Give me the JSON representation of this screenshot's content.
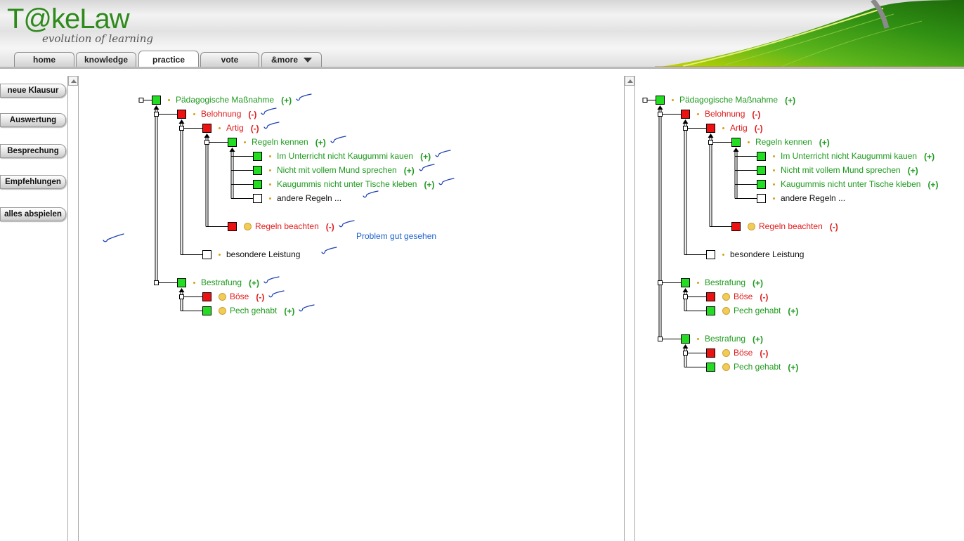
{
  "app": {
    "logo": "T@keLaw",
    "tagline": "evolution of learning"
  },
  "tabs": [
    {
      "label": "home",
      "active": false
    },
    {
      "label": "knowledge",
      "active": false
    },
    {
      "label": "practice",
      "active": true
    },
    {
      "label": "vote",
      "active": false
    },
    {
      "label": "&more",
      "active": false,
      "has_dropdown": true
    }
  ],
  "sidebar": {
    "buttons": [
      {
        "label": "neue Klausur"
      },
      {
        "label": "Auswertung"
      },
      {
        "label": "Besprechung"
      },
      {
        "label": "Empfehlungen"
      },
      {
        "label": "alles abspielen"
      }
    ]
  },
  "colors": {
    "green": "#1f9a1f",
    "box_green": "#22dd22",
    "red": "#e01b1b",
    "box_red": "#ee1111",
    "comment": "#1f62d1",
    "annotation_ink": "#1b3fb5",
    "bullet": "#d4a017",
    "circle": "#f2cc55"
  },
  "left_panel": {
    "nodes": [
      {
        "id": "L1",
        "label": "Pädagogische Maßnahme",
        "sign": "(+)",
        "box": "green",
        "color": "green",
        "level": 0,
        "row": 0,
        "circle": false
      },
      {
        "id": "L2",
        "label": "Belohnung",
        "sign": "(-)",
        "box": "red",
        "color": "red",
        "level": 1,
        "row": 1,
        "circle": false
      },
      {
        "id": "L3",
        "label": "Artig",
        "sign": "(-)",
        "box": "red",
        "color": "red",
        "level": 2,
        "row": 2,
        "circle": false
      },
      {
        "id": "L4",
        "label": "Regeln kennen",
        "sign": "(+)",
        "box": "green",
        "color": "green",
        "level": 3,
        "row": 3,
        "circle": false
      },
      {
        "id": "L5",
        "label": "Im Unterricht nicht Kaugummi kauen",
        "sign": "(+)",
        "box": "green",
        "color": "green",
        "level": 4,
        "row": 4,
        "circle": false
      },
      {
        "id": "L6",
        "label": "Nicht mit vollem Mund sprechen",
        "sign": "(+)",
        "box": "green",
        "color": "green",
        "level": 4,
        "row": 5,
        "circle": false
      },
      {
        "id": "L7",
        "label": "Kaugummis nicht unter Tische kleben",
        "sign": "(+)",
        "box": "green",
        "color": "green",
        "level": 4,
        "row": 6,
        "circle": false
      },
      {
        "id": "L8",
        "label": "andere Regeln ...",
        "sign": "",
        "box": "white",
        "color": "black",
        "level": 4,
        "row": 7,
        "circle": false
      },
      {
        "id": "L9",
        "label": "Regeln beachten",
        "sign": "(-)",
        "box": "red",
        "color": "red",
        "level": 3,
        "row": 9,
        "circle": true
      },
      {
        "id": "L10",
        "label": "besondere Leistung",
        "sign": "",
        "box": "white",
        "color": "black",
        "level": 2,
        "row": 11,
        "circle": false
      },
      {
        "id": "L11",
        "label": "Bestrafung",
        "sign": "(+)",
        "box": "green",
        "color": "green",
        "level": 1,
        "row": 13,
        "circle": false
      },
      {
        "id": "L12",
        "label": "Böse",
        "sign": "(-)",
        "box": "red",
        "color": "red",
        "level": 2,
        "row": 14,
        "circle": true
      },
      {
        "id": "L13",
        "label": "Pech gehabt",
        "sign": "(+)",
        "box": "green",
        "color": "green",
        "level": 2,
        "row": 15,
        "circle": true
      }
    ],
    "comment": "Problem gut gesehen"
  },
  "right_panel": {
    "nodes": [
      {
        "id": "R1",
        "label": "Pädagogische Maßnahme",
        "sign": "(+)",
        "box": "green",
        "color": "green",
        "level": 0,
        "row": 0,
        "circle": false
      },
      {
        "id": "R2",
        "label": "Belohnung",
        "sign": "(-)",
        "box": "red",
        "color": "red",
        "level": 1,
        "row": 1,
        "circle": false
      },
      {
        "id": "R3",
        "label": "Artig",
        "sign": "(-)",
        "box": "red",
        "color": "red",
        "level": 2,
        "row": 2,
        "circle": false
      },
      {
        "id": "R4",
        "label": "Regeln kennen",
        "sign": "(+)",
        "box": "green",
        "color": "green",
        "level": 3,
        "row": 3,
        "circle": false
      },
      {
        "id": "R5",
        "label": "Im Unterricht nicht Kaugummi kauen",
        "sign": "(+)",
        "box": "green",
        "color": "green",
        "level": 4,
        "row": 4,
        "circle": false
      },
      {
        "id": "R6",
        "label": "Nicht mit vollem Mund sprechen",
        "sign": "(+)",
        "box": "green",
        "color": "green",
        "level": 4,
        "row": 5,
        "circle": false
      },
      {
        "id": "R7",
        "label": "Kaugummis nicht unter Tische kleben",
        "sign": "(+)",
        "box": "green",
        "color": "green",
        "level": 4,
        "row": 6,
        "circle": false
      },
      {
        "id": "R8",
        "label": "andere Regeln ...",
        "sign": "",
        "box": "white",
        "color": "black",
        "level": 4,
        "row": 7,
        "circle": false
      },
      {
        "id": "R9",
        "label": "Regeln beachten",
        "sign": "(-)",
        "box": "red",
        "color": "red",
        "level": 3,
        "row": 9,
        "circle": true
      },
      {
        "id": "R10",
        "label": "besondere Leistung",
        "sign": "",
        "box": "white",
        "color": "black",
        "level": 2,
        "row": 11,
        "circle": false
      },
      {
        "id": "R11",
        "label": "Bestrafung",
        "sign": "(+)",
        "box": "green",
        "color": "green",
        "level": 1,
        "row": 13,
        "circle": false
      },
      {
        "id": "R12",
        "label": "Böse",
        "sign": "(-)",
        "box": "red",
        "color": "red",
        "level": 2,
        "row": 14,
        "circle": true
      },
      {
        "id": "R13",
        "label": "Pech gehabt",
        "sign": "(+)",
        "box": "green",
        "color": "green",
        "level": 2,
        "row": 15,
        "circle": true
      },
      {
        "id": "R14",
        "label": "Bestrafung",
        "sign": "(+)",
        "box": "green",
        "color": "green",
        "level": 1,
        "row": 17,
        "circle": false
      },
      {
        "id": "R15",
        "label": "Böse",
        "sign": "(-)",
        "box": "red",
        "color": "red",
        "level": 2,
        "row": 18,
        "circle": true
      },
      {
        "id": "R16",
        "label": "Pech gehabt",
        "sign": "(+)",
        "box": "green",
        "color": "green",
        "level": 2,
        "row": 19,
        "circle": true
      }
    ]
  }
}
